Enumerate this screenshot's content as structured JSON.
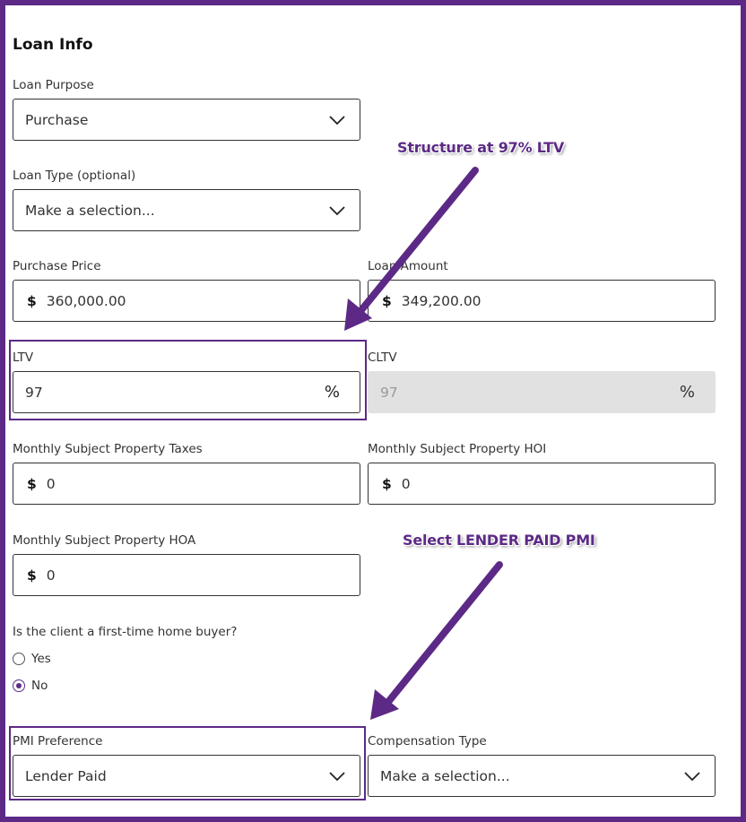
{
  "form": {
    "title": "Loan Info",
    "loan_purpose": {
      "label": "Loan Purpose",
      "value": "Purchase"
    },
    "loan_type": {
      "label": "Loan Type (optional)",
      "value": "Make a selection..."
    },
    "purchase_price": {
      "label": "Purchase Price",
      "currency": "$",
      "value": "360,000.00"
    },
    "loan_amount": {
      "label": "Loan Amount",
      "currency": "$",
      "value": "349,200.00"
    },
    "ltv": {
      "label": "LTV",
      "value": "97",
      "unit": "%"
    },
    "cltv": {
      "label": "CLTV",
      "value": "97",
      "unit": "%"
    },
    "taxes": {
      "label": "Monthly Subject Property Taxes",
      "currency": "$",
      "value": "0"
    },
    "hoi": {
      "label": "Monthly Subject Property HOI",
      "currency": "$",
      "value": "0"
    },
    "hoa": {
      "label": "Monthly Subject Property HOA",
      "currency": "$",
      "value": "0"
    },
    "first_time": {
      "question": "Is the client a first-time home buyer?",
      "yes": "Yes",
      "no": "No",
      "selected": "No"
    },
    "pmi": {
      "label": "PMI Preference",
      "value": "Lender Paid"
    },
    "compensation": {
      "label": "Compensation Type",
      "value": "Make a selection..."
    }
  },
  "annotations": {
    "note_ltv": "Structure at 97% LTV",
    "note_pmi": "Select LENDER PAID PMI"
  },
  "icons": {
    "dropdown": "chevron-down-icon",
    "arrow": "arrow-icon"
  },
  "colors": {
    "accent": "#5c2a86",
    "disabled_bg": "#e1e1e1",
    "border": "#333333"
  }
}
